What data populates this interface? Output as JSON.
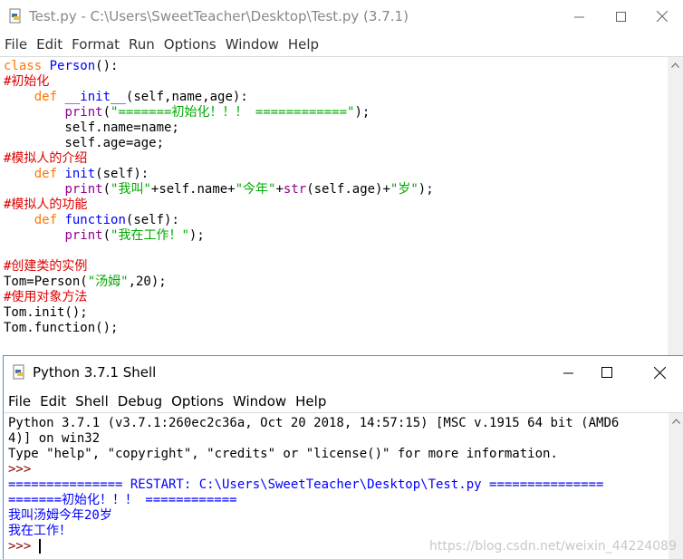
{
  "editor": {
    "title": "Test.py - C:\\Users\\SweetTeacher\\Desktop\\Test.py (3.7.1)",
    "menu": [
      "File",
      "Edit",
      "Format",
      "Run",
      "Options",
      "Window",
      "Help"
    ],
    "code": {
      "l1_kw": "class",
      "l1_name": "Person",
      "l1_rest": "():",
      "l2": "#初始化",
      "l3_indent": "    ",
      "l3_kw": "def",
      "l3_name": "__init__",
      "l3_rest": "(self,name,age):",
      "l4_indent": "        ",
      "l4_bi": "print",
      "l4_p1": "(",
      "l4_str": "\"=======初始化！！！ ============\"",
      "l4_p2": ");",
      "l5": "        self.name=name;",
      "l6": "        self.age=age;",
      "l7": "#模拟人的介绍",
      "l8_indent": "    ",
      "l8_kw": "def",
      "l8_name": "init",
      "l8_rest": "(self):",
      "l9_indent": "        ",
      "l9_bi": "print",
      "l9_p1": "(",
      "l9_s1": "\"我叫\"",
      "l9_m1": "+self.name+",
      "l9_s2": "\"今年\"",
      "l9_m2": "+",
      "l9_bi2": "str",
      "l9_m3": "(self.age)+",
      "l9_s3": "\"岁\"",
      "l9_p2": ");",
      "l10": "#模拟人的功能",
      "l11_indent": "    ",
      "l11_kw": "def",
      "l11_name": "function",
      "l11_rest": "(self):",
      "l12_indent": "        ",
      "l12_bi": "print",
      "l12_p1": "(",
      "l12_str": "\"我在工作！\"",
      "l12_p2": ");",
      "l13": "",
      "l14": "#创建类的实例",
      "l15_a": "Tom=Person(",
      "l15_str": "\"汤姆\"",
      "l15_b": ",20);",
      "l16": "#使用对象方法",
      "l17": "Tom.init();",
      "l18": "Tom.function();"
    }
  },
  "shell": {
    "title": "Python 3.7.1 Shell",
    "menu": [
      "File",
      "Edit",
      "Shell",
      "Debug",
      "Options",
      "Window",
      "Help"
    ],
    "lines": {
      "banner1": "Python 3.7.1 (v3.7.1:260ec2c36a, Oct 20 2018, 14:57:15) [MSC v.1915 64 bit (AMD6",
      "banner2": "4)] on win32",
      "banner3": "Type \"help\", \"copyright\", \"credits\" or \"license()\" for more information.",
      "prompt1": ">>> ",
      "restart": "=============== RESTART: C:\\Users\\SweetTeacher\\Desktop\\Test.py ===============",
      "out1": "=======初始化！！！ ============",
      "out2": "我叫汤姆今年20岁",
      "out3": "我在工作！",
      "prompt2": ">>> "
    },
    "watermark": "https://blog.csdn.net/weixin_44224089"
  },
  "icons": {
    "app": "python-file-icon",
    "minimize": "minimize-icon",
    "maximize": "maximize-icon",
    "close": "close-icon"
  }
}
